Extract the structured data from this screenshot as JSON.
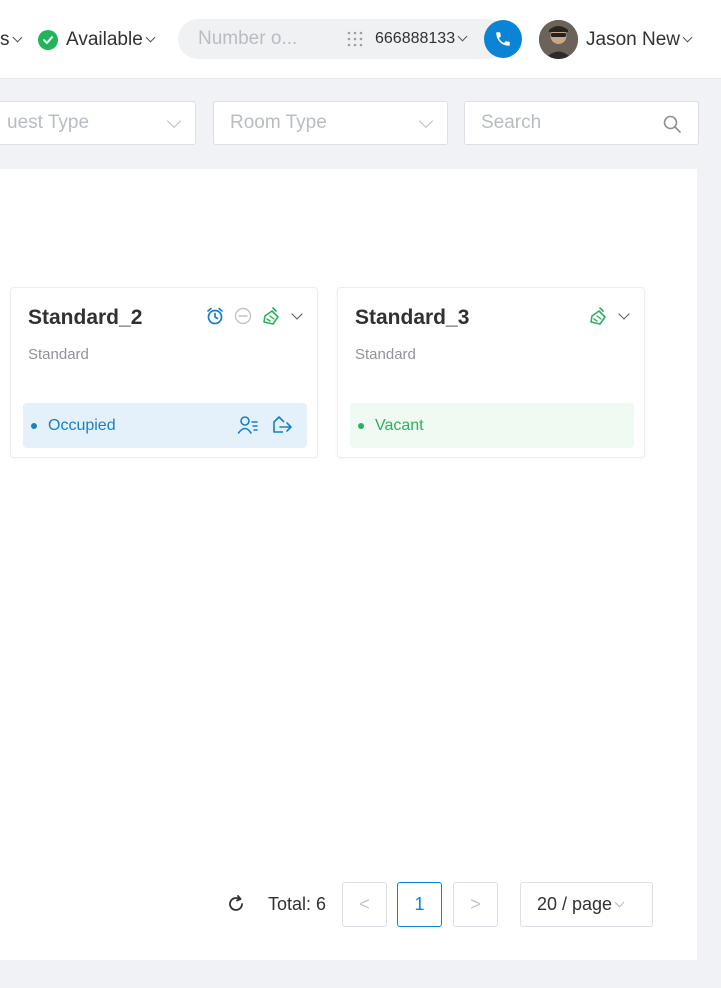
{
  "header": {
    "left_truncated": "s",
    "availability": "Available",
    "dial_placeholder": "Number o...",
    "phone_number": "666888133",
    "user_name": "Jason New"
  },
  "filters": {
    "guest_type_placeholder": "uest Type",
    "room_type_placeholder": "Room Type",
    "search_placeholder": "Search"
  },
  "rooms": [
    {
      "name": "Standard_2",
      "type": "Standard",
      "status": "Occupied"
    },
    {
      "name": "Standard_3",
      "type": "Standard",
      "status": "Vacant"
    }
  ],
  "pagination": {
    "total_label": "Total: 6",
    "prev": "<",
    "current_page": "1",
    "next": ">",
    "page_size": "20 / page"
  },
  "colors": {
    "primary": "#0b84d6",
    "available_green": "#21b45b",
    "occupied_bg": "#e4f1fb",
    "occupied_text": "#1a7fc9",
    "vacant_bg": "#effaf3",
    "vacant_text": "#2eb05e",
    "clean_icon_green": "#2eb05e"
  }
}
